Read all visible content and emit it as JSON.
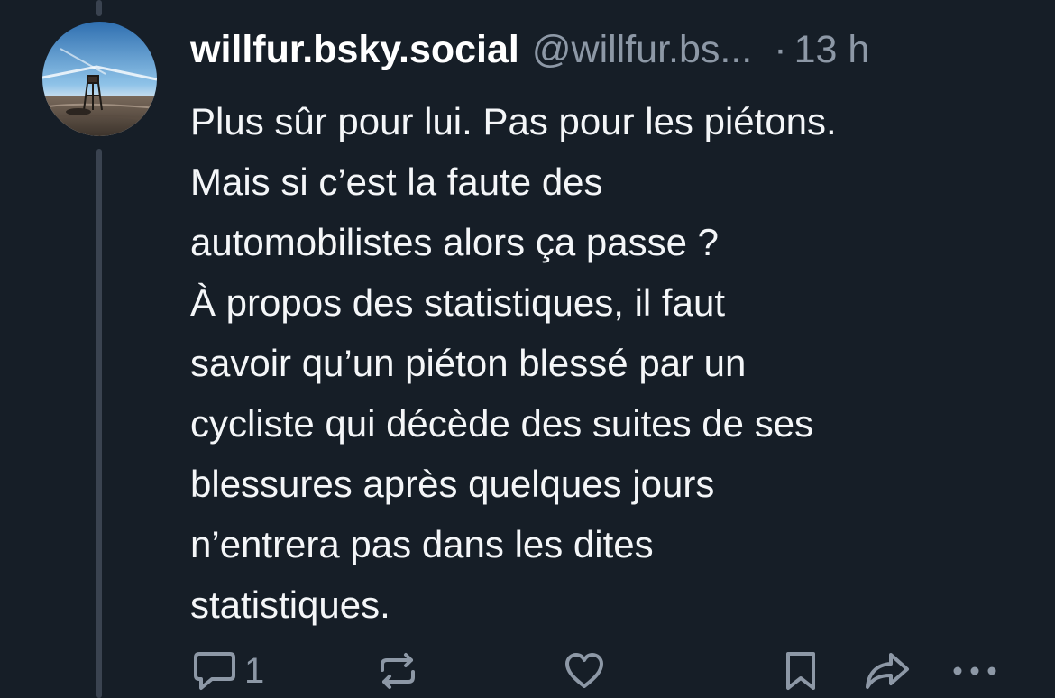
{
  "post": {
    "display_name": "willfur.bsky.social",
    "handle": "@willfur.bs...",
    "separator": "·",
    "time": "13 h",
    "text_lines": [
      "Plus sûr pour lui. Pas pour les piétons.",
      "Mais si c’est la faute des",
      "automobilistes alors ça passe ?",
      "À propos des statistiques, il faut",
      "savoir qu’un piéton blessé par un",
      "cycliste qui décède des suites de ses",
      "blessures après quelques jours",
      "n’entrera pas dans les dites",
      "statistiques."
    ]
  },
  "actions": {
    "reply_count": "1",
    "icons": [
      "reply-icon",
      "repost-icon",
      "like-icon",
      "bookmark-icon",
      "share-icon",
      "more-icon"
    ]
  },
  "colors": {
    "background": "#161e27",
    "text": "#ffffff",
    "muted": "#8d98a6",
    "thread_line": "#3a4350"
  }
}
